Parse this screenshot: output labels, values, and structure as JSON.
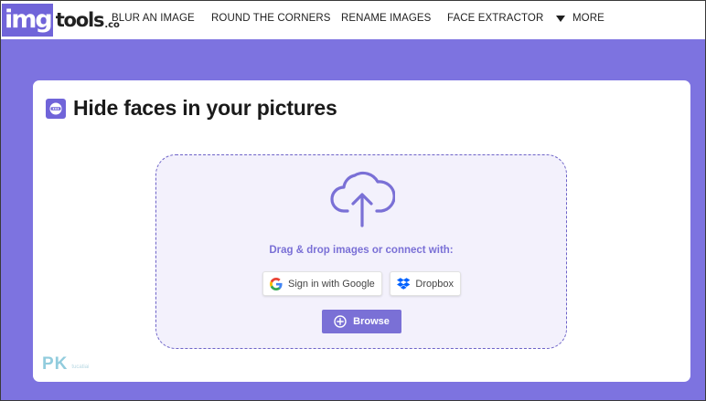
{
  "logo": {
    "img": "img",
    "tools": "tools",
    "co": ".co",
    "brand_color": "#7064d9"
  },
  "nav": {
    "items": [
      {
        "label": "BLUR AN IMAGE"
      },
      {
        "label": "ROUND THE CORNERS"
      },
      {
        "label": "RENAME IMAGES"
      },
      {
        "label": "FACE EXTRACTOR"
      }
    ],
    "more_label": "MORE",
    "more_icon": "caret-down-icon"
  },
  "page": {
    "title": "Hide faces in your pictures",
    "title_icon": "face-mask-icon",
    "background_color": "#7d73e0"
  },
  "upload": {
    "icon": "cloud-upload-icon",
    "prompt": "Drag & drop images or connect with:",
    "google_label": "Sign in with Google",
    "dropbox_label": "Dropbox",
    "browse_label": "Browse",
    "accent_color": "#7a70d6"
  },
  "watermark": {
    "main": "PK",
    "sub": "tucatiai"
  }
}
